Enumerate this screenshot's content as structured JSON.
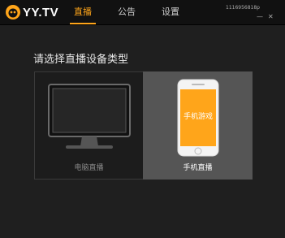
{
  "app": {
    "logo_text": "YY.TV",
    "user_id": "1116956818p"
  },
  "tabs": [
    {
      "label": "直播",
      "active": true
    },
    {
      "label": "公告",
      "active": false
    },
    {
      "label": "设置",
      "active": false
    }
  ],
  "window_controls": {
    "minimize": "—",
    "close": "✕"
  },
  "heading": "请选择直播设备类型",
  "options": [
    {
      "label": "电脑直播",
      "icon": "monitor-icon",
      "selected": false
    },
    {
      "label": "手机直播",
      "icon": "phone-icon",
      "selected": true,
      "screen_text": "手机游戏"
    }
  ],
  "colors": {
    "accent": "#ffa51a",
    "selected_bg": "#555555",
    "background": "#1f1f1f"
  }
}
